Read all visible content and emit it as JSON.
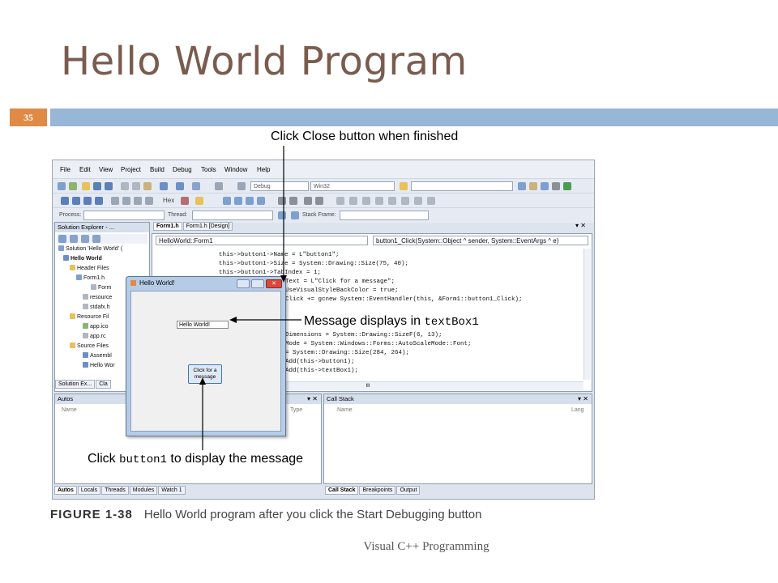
{
  "slide": {
    "title": "Hello World Program",
    "page_number": "35",
    "footer": "Visual C++ Programming",
    "figure_label": "FIGURE 1-38",
    "figure_caption": "Hello World program after you click the Start Debugging button"
  },
  "annotations": {
    "close_note": "Click Close button when finished",
    "message_note_prefix": "Message displays in ",
    "message_note_mono": "textBox1",
    "button_note_prefix": "Click ",
    "button_note_mono": "button1",
    "button_note_suffix": " to display the message"
  },
  "ide": {
    "menu": [
      "File",
      "Edit",
      "View",
      "Project",
      "Build",
      "Debug",
      "Tools",
      "Window",
      "Help"
    ],
    "config_combo": "Debug",
    "platform_combo": "Win32",
    "hex_label": "Hex",
    "process_label": "Process:",
    "thread_label": "Thread:",
    "stack_frame_label": "Stack Frame:",
    "solution_explorer": {
      "title": "Solution Explorer - ...",
      "items": [
        "Solution 'Hello World' (",
        "Hello World",
        "Header Files",
        "Form1.h",
        "Form",
        "resource",
        "stdafx.h",
        "Resource Fil",
        "app.ico",
        "app.rc",
        "Source Files",
        "Assembl",
        "Hello Wor"
      ],
      "bottom_tabs": [
        "Solution Ex...",
        "Cla"
      ]
    },
    "editor": {
      "tabs": [
        "Form1.h",
        "Form1.h [Design]"
      ],
      "scope_combo": "HelloWorld::Form1",
      "member_combo": "button1_Click(System::Object ^ sender, System::EventArgs ^ e)",
      "lines": [
        "this->button1->Name = L\"button1\";",
        "this->button1->Size = System::Drawing::Size(75, 40);",
        "this->button1->TabIndex = 1;",
        "Text = L\"Click for a message\";",
        "UseVisualStyleBackColor = true;",
        "Click += gcnew System::EventHandler(this, &Form1::button1_Click);",
        "",
        "",
        "Dimensions = System::Drawing::SizeF(6, 13);",
        "Mode = System::Windows::Forms::AutoScaleMode::Font;",
        "= System::Drawing::Size(284, 264);",
        "Add(this->button1);",
        "Add(this->textBox1);"
      ],
      "hscroll_label": "III"
    },
    "autos": {
      "title": "Autos",
      "col_name": "Name",
      "col_type": "Type",
      "bottom_tabs": [
        "Autos",
        "Locals",
        "Threads",
        "Modules",
        "Watch 1"
      ]
    },
    "callstack": {
      "title": "Call Stack",
      "col_name": "Name",
      "col_lang": "Lang",
      "bottom_tabs": [
        "Call Stack",
        "Breakpoints",
        "Output"
      ]
    }
  },
  "app_window": {
    "title": "Hello World!",
    "textbox_value": "Hello World!",
    "button_label": "Click for a message"
  },
  "colors": {
    "title": "#7a5c4f",
    "slide_bar": "#98b6d6",
    "page_badge": "#e08a45",
    "app_close_button": "#d9483b"
  }
}
